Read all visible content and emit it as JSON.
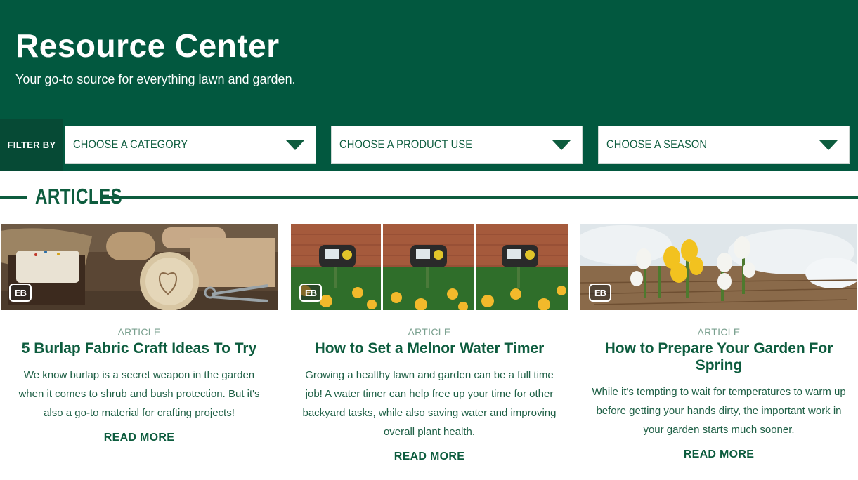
{
  "header": {
    "title": "Resource Center",
    "subtitle": "Your go-to source for everything lawn and garden.",
    "background_color": "#02583f"
  },
  "filters": {
    "label": "FILTER BY",
    "selects": [
      {
        "value": "CHOOSE A CATEGORY",
        "icon": "chevron-down-icon"
      },
      {
        "value": "CHOOSE A PRODUCT USE",
        "icon": "chevron-down-icon"
      },
      {
        "value": "CHOOSE A SEASON",
        "icon": "chevron-down-icon"
      }
    ]
  },
  "section": {
    "title": "ARTICLES"
  },
  "cards": [
    {
      "badge": "EB",
      "kicker": "ARTICLE",
      "title": "5 Burlap Fabric Craft Ideas To Try",
      "description": "We know burlap is a secret weapon in the garden when it comes to shrub and bush protection. But it's also a go-to material for crafting projects!",
      "cta": "READ MORE"
    },
    {
      "badge": "EB",
      "kicker": "ARTICLE",
      "title": "How to Set a Melnor Water Timer",
      "description": "Growing a healthy lawn and garden can be a full time job! A water timer can help free up your time for other backyard tasks, while also saving water and improving overall plant health.",
      "cta": "READ MORE"
    },
    {
      "badge": "EB",
      "kicker": "ARTICLE",
      "title": "How to Prepare Your Garden For Spring",
      "description": "While it's tempting to wait for temperatures to warm up before getting your hands dirty, the important work in your garden starts much sooner.",
      "cta": "READ MORE"
    }
  ],
  "colors": {
    "brand_green": "#0d5c3e",
    "kicker_gray": "#7aa08f"
  }
}
